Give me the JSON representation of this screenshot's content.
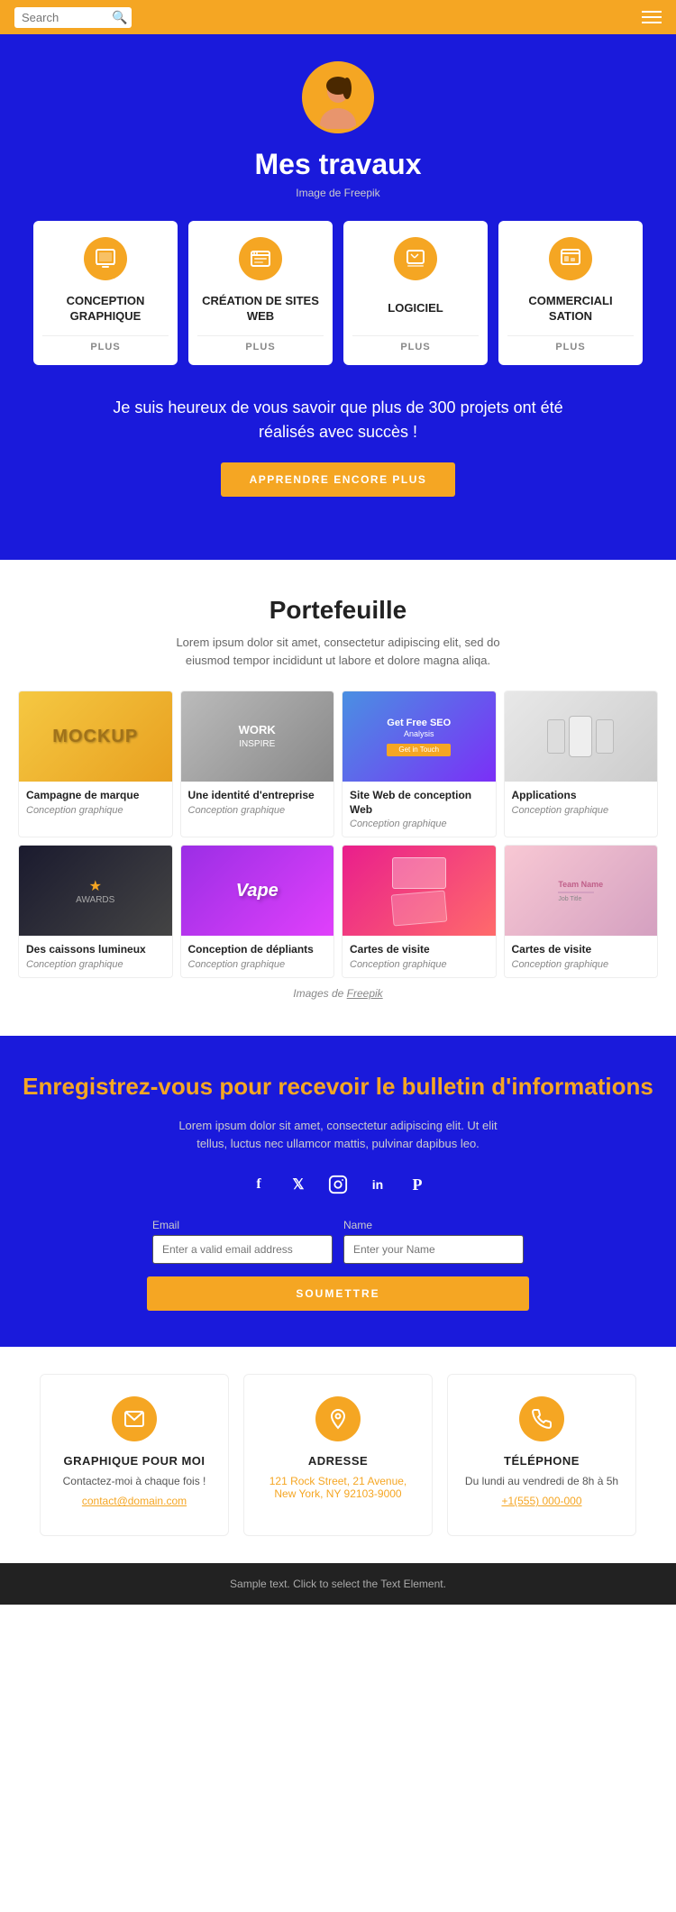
{
  "header": {
    "search_placeholder": "Search",
    "menu_label": "Menu"
  },
  "hero": {
    "title": "Mes travaux",
    "image_credit": "Image de Freepik",
    "image_credit_link": "Freepik"
  },
  "services": [
    {
      "id": "conception-graphique",
      "title": "CONCEPTION GRAPHIQUE",
      "plus": "PLUS",
      "icon": "🖼"
    },
    {
      "id": "creation-sites-web",
      "title": "CRÉATION DE SITES WEB",
      "plus": "PLUS",
      "icon": "💻"
    },
    {
      "id": "logiciel",
      "title": "LOGICIEL",
      "plus": "PLUS",
      "icon": "🖥"
    },
    {
      "id": "commercialisation",
      "title": "COMMERCIALI SATION",
      "plus": "PLUS",
      "icon": "📊"
    }
  ],
  "promo": {
    "text": "Je suis heureux de vous savoir que plus de 300 projets ont été réalisés avec succès !",
    "button_label": "APPRENDRE ENCORE PLUS"
  },
  "portfolio": {
    "title": "Portefeuille",
    "subtitle": "Lorem ipsum dolor sit amet, consectetur adipiscing elit, sed do eiusmod tempor incididunt ut labore et dolore magna aliqa.",
    "image_credit": "Images de Freepik",
    "image_credit_link": "Freepik",
    "items": [
      {
        "title": "Campagne de marque",
        "category": "Conception graphique",
        "img": "mockup"
      },
      {
        "title": "Une identité d'entreprise",
        "category": "Conception graphique",
        "img": "work"
      },
      {
        "title": "Site Web de conception Web",
        "category": "Conception graphique",
        "img": "seo"
      },
      {
        "title": "Applications",
        "category": "Conception graphique",
        "img": "phones"
      },
      {
        "title": "Des caissons lumineux",
        "category": "Conception graphique",
        "img": "dark"
      },
      {
        "title": "Conception de dépliants",
        "category": "Conception graphique",
        "img": "purple"
      },
      {
        "title": "Cartes de visite",
        "category": "Conception graphique",
        "img": "cards"
      },
      {
        "title": "Cartes de visite",
        "category": "Conception graphique",
        "img": "pastel"
      }
    ]
  },
  "newsletter": {
    "title": "Enregistrez-vous pour recevoir le bulletin d'informations",
    "subtitle": "Lorem ipsum dolor sit amet, consectetur adipiscing elit. Ut elit tellus, luctus nec ullamcor mattis, pulvinar dapibus leo.",
    "email_label": "Email",
    "email_placeholder": "Enter a valid email address",
    "name_label": "Name",
    "name_placeholder": "Enter your Name",
    "submit_label": "SOUMETTRE"
  },
  "social": [
    {
      "name": "facebook",
      "icon": "f"
    },
    {
      "name": "twitter",
      "icon": "t"
    },
    {
      "name": "instagram",
      "icon": "in"
    },
    {
      "name": "linkedin",
      "icon": "li"
    },
    {
      "name": "pinterest",
      "icon": "p"
    }
  ],
  "contact": [
    {
      "id": "graphique",
      "title": "GRAPHIQUE POUR MOI",
      "text": "Contactez-moi à chaque fois !",
      "link_text": "contact@domain.com",
      "icon": "✉"
    },
    {
      "id": "address",
      "title": "ADRESSE",
      "text": "121 Rock Street, 21 Avenue,\nNew York, NY 92103-9000",
      "link_text": "121 Rock Street, 21 Avenue, New York, NY 92103-9000",
      "icon": "📍"
    },
    {
      "id": "telephone",
      "title": "TÉLÉPHONE",
      "text": "Du lundi au vendredi de 8h à 5h",
      "link_text": "+1(555) 000-000",
      "icon": "📞"
    }
  ],
  "footer": {
    "text": "Sample text. Click to select the Text Element."
  }
}
